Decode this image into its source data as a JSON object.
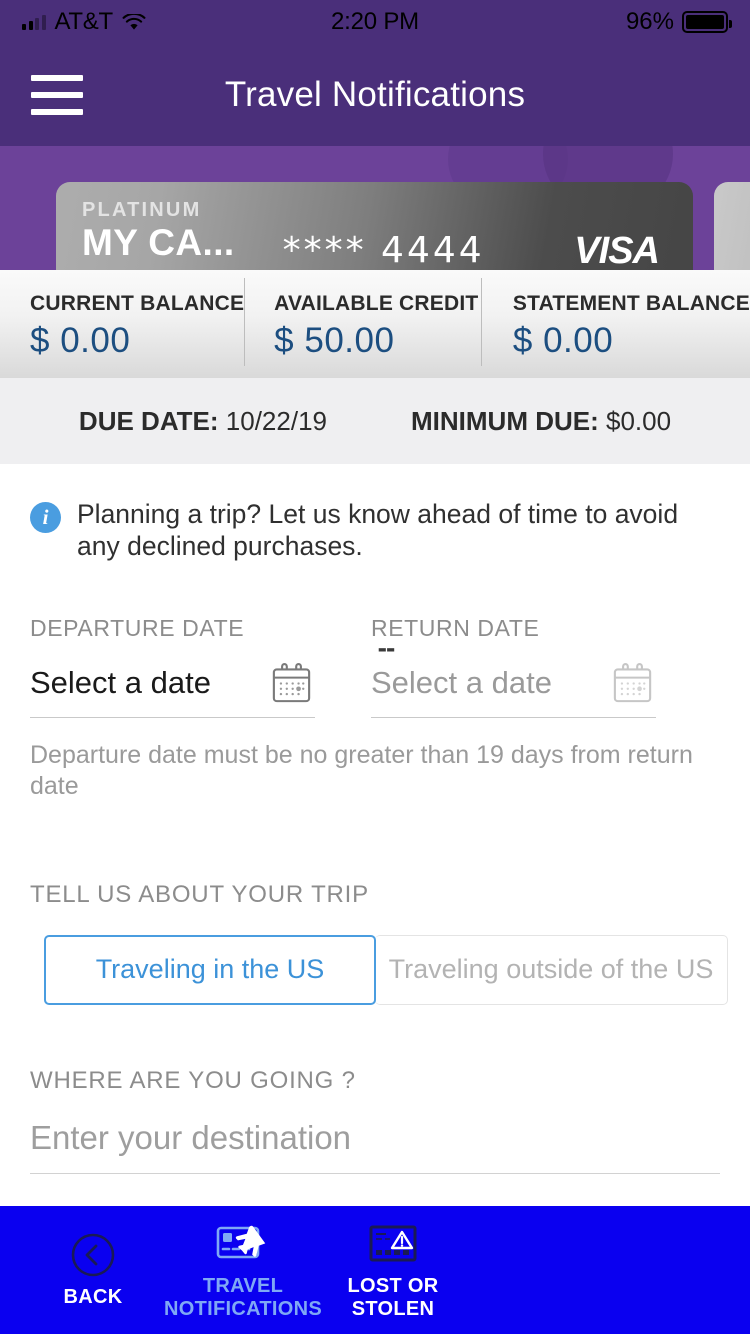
{
  "status_bar": {
    "carrier": "AT&T",
    "time": "2:20 PM",
    "battery_percent": "96%",
    "signal_icon": "signal-bars-icon",
    "wifi_icon": "wifi-icon",
    "battery_icon": "battery-icon"
  },
  "header": {
    "title": "Travel Notifications",
    "menu_icon": "hamburger-menu-icon",
    "background_color": "#4A2F7A"
  },
  "card": {
    "tier": "PLATINUM",
    "nickname": "MY CA...",
    "masked_number": "**** 4444",
    "brand": "VISA",
    "carousel_background": "#6C4299"
  },
  "balances": [
    {
      "label": "CURRENT BALANCE",
      "value": "$ 0.00"
    },
    {
      "label": "AVAILABLE CREDIT",
      "value": "$ 50.00"
    },
    {
      "label": "STATEMENT BALANCE",
      "value": "$ 0.00"
    }
  ],
  "due_bar": {
    "due_date_label": "DUE DATE:",
    "due_date_value": "10/22/19",
    "minimum_due_label": "MINIMUM DUE:",
    "minimum_due_value": "$0.00"
  },
  "info_banner": {
    "icon": "info-icon",
    "text": "Planning a trip? Let us know ahead of time to avoid any declined purchases."
  },
  "dates": {
    "departure_label": "DEPARTURE DATE",
    "departure_placeholder": "Select a date",
    "separator": "--",
    "return_label": "RETURN DATE",
    "return_placeholder": "Select a date",
    "calendar_icon": "calendar-icon",
    "help_text": "Departure date must be no greater than 19 days from return date"
  },
  "trip": {
    "section_label": "TELL US ABOUT YOUR TRIP",
    "option_in_us": "Traveling in the US",
    "option_outside_us": "Traveling outside of the US",
    "selected": "Traveling in the US",
    "accent_color": "#4A9DE0"
  },
  "destination": {
    "label": "WHERE ARE YOU GOING ?",
    "placeholder": "Enter your destination",
    "value": ""
  },
  "tabbar": {
    "background_color": "#0A00F0",
    "items": [
      {
        "label": "BACK",
        "icon": "chevron-left-circle-icon",
        "state": "normal"
      },
      {
        "label": "TRAVEL\nNOTIFICATIONS",
        "label_line1": "TRAVEL",
        "label_line2": "NOTIFICATIONS",
        "icon": "card-airplane-icon",
        "state": "active"
      },
      {
        "label": "LOST OR\nSTOLEN",
        "label_line1": "LOST OR",
        "label_line2": "STOLEN",
        "icon": "card-warning-icon",
        "state": "normal"
      }
    ]
  }
}
